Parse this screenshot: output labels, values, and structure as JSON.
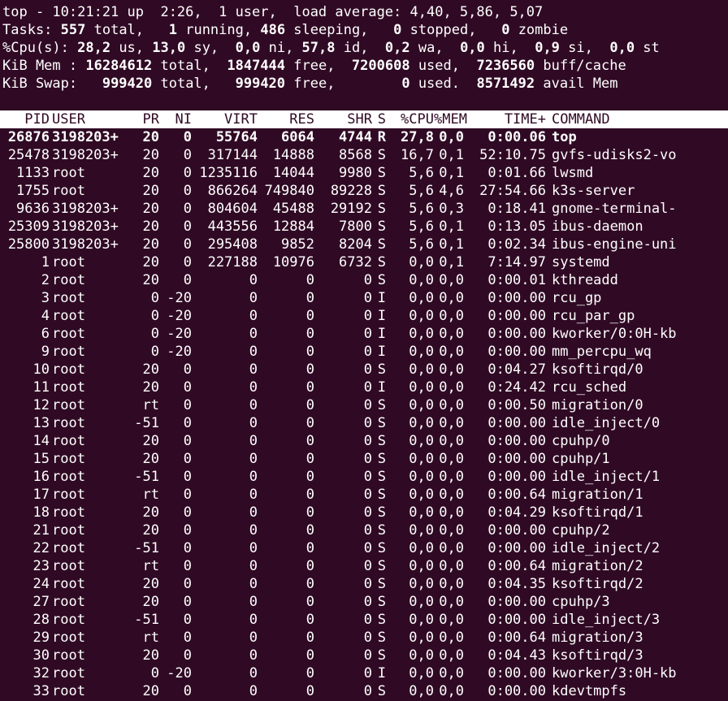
{
  "summary": {
    "line1": "top - 10:21:21 up  2:26,  1 user,  load average: 4,40, 5,86, 5,07",
    "tasks": {
      "label": "Tasks: ",
      "total": "557",
      "total_label": " total,   ",
      "running": "1",
      "running_label": " running, ",
      "sleeping": "486",
      "sleeping_label": " sleeping,   ",
      "stopped": "0",
      "stopped_label": " stopped,   ",
      "zombie": "0",
      "zombie_label": " zombie"
    },
    "cpu": {
      "label": "%Cpu(s): ",
      "us": "28,2",
      "us_label": " us, ",
      "sy": "13,0",
      "sy_label": " sy,  ",
      "ni": "0,0",
      "ni_label": " ni, ",
      "id": "57,8",
      "id_label": " id,  ",
      "wa": "0,2",
      "wa_label": " wa,  ",
      "hi": "0,0",
      "hi_label": " hi,  ",
      "si": "0,9",
      "si_label": " si,  ",
      "st": "0,0",
      "st_label": " st"
    },
    "mem": {
      "label": "KiB Mem : ",
      "total": "16284612",
      "total_label": " total,  ",
      "free": "1847444",
      "free_label": " free,  ",
      "used": "7200608",
      "used_label": " used,  ",
      "cache": "7236560",
      "cache_label": " buff/cache"
    },
    "swap": {
      "label": "KiB Swap:   ",
      "total": "999420",
      "total_label": " total,   ",
      "free": "999420",
      "free_label": " free,        ",
      "used": "0",
      "used_label": " used.  ",
      "avail": "8571492",
      "avail_label": " avail Mem"
    }
  },
  "columns": {
    "pid": "PID",
    "user": "USER",
    "pr": "PR",
    "ni": "NI",
    "virt": "VIRT",
    "res": "RES",
    "shr": "SHR",
    "s": "S",
    "cpu": "%CPU",
    "mem": "%MEM",
    "time": "TIME+",
    "command": "COMMAND"
  },
  "processes": [
    {
      "pid": "26876",
      "user": "3198203+",
      "pr": "20",
      "ni": "0",
      "virt": "55764",
      "res": "6064",
      "shr": "4744",
      "s": "R",
      "cpu": "27,8",
      "mem": "0,0",
      "time": "0:00.06",
      "command": "top",
      "bold": true
    },
    {
      "pid": "25478",
      "user": "3198203+",
      "pr": "20",
      "ni": "0",
      "virt": "317144",
      "res": "14888",
      "shr": "8568",
      "s": "S",
      "cpu": "16,7",
      "mem": "0,1",
      "time": "52:10.75",
      "command": "gvfs-udisks2-vo"
    },
    {
      "pid": "1133",
      "user": "root",
      "pr": "20",
      "ni": "0",
      "virt": "1235116",
      "res": "14044",
      "shr": "9980",
      "s": "S",
      "cpu": "5,6",
      "mem": "0,1",
      "time": "0:01.66",
      "command": "lwsmd"
    },
    {
      "pid": "1755",
      "user": "root",
      "pr": "20",
      "ni": "0",
      "virt": "866264",
      "res": "749840",
      "shr": "89228",
      "s": "S",
      "cpu": "5,6",
      "mem": "4,6",
      "time": "27:54.66",
      "command": "k3s-server"
    },
    {
      "pid": "9636",
      "user": "3198203+",
      "pr": "20",
      "ni": "0",
      "virt": "804604",
      "res": "45488",
      "shr": "29192",
      "s": "S",
      "cpu": "5,6",
      "mem": "0,3",
      "time": "0:18.41",
      "command": "gnome-terminal-"
    },
    {
      "pid": "25309",
      "user": "3198203+",
      "pr": "20",
      "ni": "0",
      "virt": "443556",
      "res": "12884",
      "shr": "7800",
      "s": "S",
      "cpu": "5,6",
      "mem": "0,1",
      "time": "0:13.05",
      "command": "ibus-daemon"
    },
    {
      "pid": "25800",
      "user": "3198203+",
      "pr": "20",
      "ni": "0",
      "virt": "295408",
      "res": "9852",
      "shr": "8204",
      "s": "S",
      "cpu": "5,6",
      "mem": "0,1",
      "time": "0:02.34",
      "command": "ibus-engine-uni"
    },
    {
      "pid": "1",
      "user": "root",
      "pr": "20",
      "ni": "0",
      "virt": "227188",
      "res": "10976",
      "shr": "6732",
      "s": "S",
      "cpu": "0,0",
      "mem": "0,1",
      "time": "7:14.97",
      "command": "systemd"
    },
    {
      "pid": "2",
      "user": "root",
      "pr": "20",
      "ni": "0",
      "virt": "0",
      "res": "0",
      "shr": "0",
      "s": "S",
      "cpu": "0,0",
      "mem": "0,0",
      "time": "0:00.01",
      "command": "kthreadd"
    },
    {
      "pid": "3",
      "user": "root",
      "pr": "0",
      "ni": "-20",
      "virt": "0",
      "res": "0",
      "shr": "0",
      "s": "I",
      "cpu": "0,0",
      "mem": "0,0",
      "time": "0:00.00",
      "command": "rcu_gp"
    },
    {
      "pid": "4",
      "user": "root",
      "pr": "0",
      "ni": "-20",
      "virt": "0",
      "res": "0",
      "shr": "0",
      "s": "I",
      "cpu": "0,0",
      "mem": "0,0",
      "time": "0:00.00",
      "command": "rcu_par_gp"
    },
    {
      "pid": "6",
      "user": "root",
      "pr": "0",
      "ni": "-20",
      "virt": "0",
      "res": "0",
      "shr": "0",
      "s": "I",
      "cpu": "0,0",
      "mem": "0,0",
      "time": "0:00.00",
      "command": "kworker/0:0H-kb"
    },
    {
      "pid": "9",
      "user": "root",
      "pr": "0",
      "ni": "-20",
      "virt": "0",
      "res": "0",
      "shr": "0",
      "s": "I",
      "cpu": "0,0",
      "mem": "0,0",
      "time": "0:00.00",
      "command": "mm_percpu_wq"
    },
    {
      "pid": "10",
      "user": "root",
      "pr": "20",
      "ni": "0",
      "virt": "0",
      "res": "0",
      "shr": "0",
      "s": "S",
      "cpu": "0,0",
      "mem": "0,0",
      "time": "0:04.27",
      "command": "ksoftirqd/0"
    },
    {
      "pid": "11",
      "user": "root",
      "pr": "20",
      "ni": "0",
      "virt": "0",
      "res": "0",
      "shr": "0",
      "s": "I",
      "cpu": "0,0",
      "mem": "0,0",
      "time": "0:24.42",
      "command": "rcu_sched"
    },
    {
      "pid": "12",
      "user": "root",
      "pr": "rt",
      "ni": "0",
      "virt": "0",
      "res": "0",
      "shr": "0",
      "s": "S",
      "cpu": "0,0",
      "mem": "0,0",
      "time": "0:00.50",
      "command": "migration/0"
    },
    {
      "pid": "13",
      "user": "root",
      "pr": "-51",
      "ni": "0",
      "virt": "0",
      "res": "0",
      "shr": "0",
      "s": "S",
      "cpu": "0,0",
      "mem": "0,0",
      "time": "0:00.00",
      "command": "idle_inject/0"
    },
    {
      "pid": "14",
      "user": "root",
      "pr": "20",
      "ni": "0",
      "virt": "0",
      "res": "0",
      "shr": "0",
      "s": "S",
      "cpu": "0,0",
      "mem": "0,0",
      "time": "0:00.00",
      "command": "cpuhp/0"
    },
    {
      "pid": "15",
      "user": "root",
      "pr": "20",
      "ni": "0",
      "virt": "0",
      "res": "0",
      "shr": "0",
      "s": "S",
      "cpu": "0,0",
      "mem": "0,0",
      "time": "0:00.00",
      "command": "cpuhp/1"
    },
    {
      "pid": "16",
      "user": "root",
      "pr": "-51",
      "ni": "0",
      "virt": "0",
      "res": "0",
      "shr": "0",
      "s": "S",
      "cpu": "0,0",
      "mem": "0,0",
      "time": "0:00.00",
      "command": "idle_inject/1"
    },
    {
      "pid": "17",
      "user": "root",
      "pr": "rt",
      "ni": "0",
      "virt": "0",
      "res": "0",
      "shr": "0",
      "s": "S",
      "cpu": "0,0",
      "mem": "0,0",
      "time": "0:00.64",
      "command": "migration/1"
    },
    {
      "pid": "18",
      "user": "root",
      "pr": "20",
      "ni": "0",
      "virt": "0",
      "res": "0",
      "shr": "0",
      "s": "S",
      "cpu": "0,0",
      "mem": "0,0",
      "time": "0:04.29",
      "command": "ksoftirqd/1"
    },
    {
      "pid": "21",
      "user": "root",
      "pr": "20",
      "ni": "0",
      "virt": "0",
      "res": "0",
      "shr": "0",
      "s": "S",
      "cpu": "0,0",
      "mem": "0,0",
      "time": "0:00.00",
      "command": "cpuhp/2"
    },
    {
      "pid": "22",
      "user": "root",
      "pr": "-51",
      "ni": "0",
      "virt": "0",
      "res": "0",
      "shr": "0",
      "s": "S",
      "cpu": "0,0",
      "mem": "0,0",
      "time": "0:00.00",
      "command": "idle_inject/2"
    },
    {
      "pid": "23",
      "user": "root",
      "pr": "rt",
      "ni": "0",
      "virt": "0",
      "res": "0",
      "shr": "0",
      "s": "S",
      "cpu": "0,0",
      "mem": "0,0",
      "time": "0:00.64",
      "command": "migration/2"
    },
    {
      "pid": "24",
      "user": "root",
      "pr": "20",
      "ni": "0",
      "virt": "0",
      "res": "0",
      "shr": "0",
      "s": "S",
      "cpu": "0,0",
      "mem": "0,0",
      "time": "0:04.35",
      "command": "ksoftirqd/2"
    },
    {
      "pid": "27",
      "user": "root",
      "pr": "20",
      "ni": "0",
      "virt": "0",
      "res": "0",
      "shr": "0",
      "s": "S",
      "cpu": "0,0",
      "mem": "0,0",
      "time": "0:00.00",
      "command": "cpuhp/3"
    },
    {
      "pid": "28",
      "user": "root",
      "pr": "-51",
      "ni": "0",
      "virt": "0",
      "res": "0",
      "shr": "0",
      "s": "S",
      "cpu": "0,0",
      "mem": "0,0",
      "time": "0:00.00",
      "command": "idle_inject/3"
    },
    {
      "pid": "29",
      "user": "root",
      "pr": "rt",
      "ni": "0",
      "virt": "0",
      "res": "0",
      "shr": "0",
      "s": "S",
      "cpu": "0,0",
      "mem": "0,0",
      "time": "0:00.64",
      "command": "migration/3"
    },
    {
      "pid": "30",
      "user": "root",
      "pr": "20",
      "ni": "0",
      "virt": "0",
      "res": "0",
      "shr": "0",
      "s": "S",
      "cpu": "0,0",
      "mem": "0,0",
      "time": "0:04.43",
      "command": "ksoftirqd/3"
    },
    {
      "pid": "32",
      "user": "root",
      "pr": "0",
      "ni": "-20",
      "virt": "0",
      "res": "0",
      "shr": "0",
      "s": "I",
      "cpu": "0,0",
      "mem": "0,0",
      "time": "0:00.00",
      "command": "kworker/3:0H-kb"
    },
    {
      "pid": "33",
      "user": "root",
      "pr": "20",
      "ni": "0",
      "virt": "0",
      "res": "0",
      "shr": "0",
      "s": "S",
      "cpu": "0,0",
      "mem": "0,0",
      "time": "0:00.00",
      "command": "kdevtmpfs"
    }
  ],
  "colors": {
    "background": "#300a24",
    "foreground": "#ffffff",
    "header_band_bg": "#ffffff",
    "header_band_fg": "#300a24"
  }
}
